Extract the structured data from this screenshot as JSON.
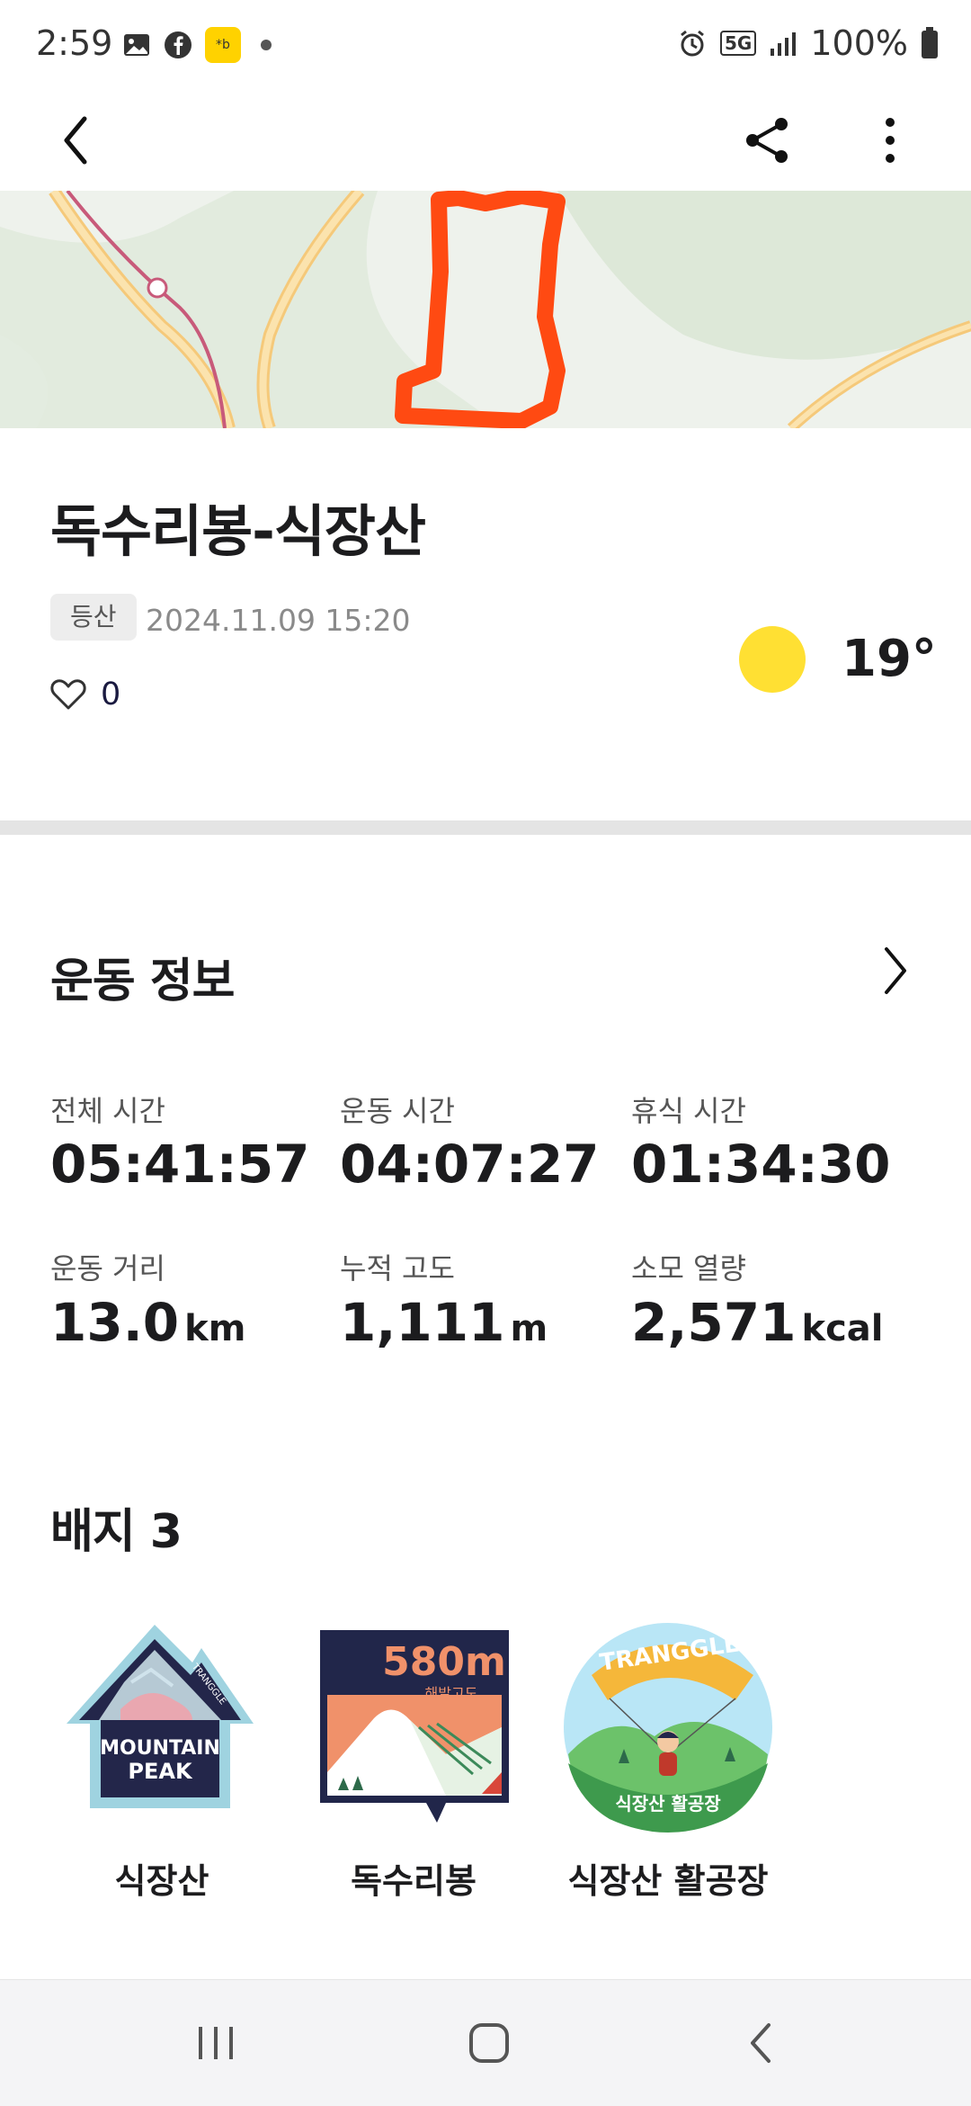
{
  "status_bar": {
    "time": "2:59",
    "network": "5G",
    "battery": "100%",
    "icons": [
      "gallery-icon",
      "facebook-icon",
      "kakao-icon",
      "dot-icon",
      "alarm-icon",
      "signal-icon",
      "battery-icon"
    ]
  },
  "header": {
    "icons": [
      "back-arrow-icon",
      "share-icon",
      "more-vertical-icon"
    ]
  },
  "activity": {
    "title": "독수리봉-식장산",
    "tag": "등산",
    "datetime": "2024.11.09 15:20",
    "likes": "0",
    "temperature": "19°",
    "weather_icon": "sun-icon",
    "route_color": "#ff4a12"
  },
  "exercise": {
    "title": "운동 정보",
    "stats": [
      {
        "label": "전체 시간",
        "value": "05:41:57",
        "unit": ""
      },
      {
        "label": "운동 시간",
        "value": "04:07:27",
        "unit": ""
      },
      {
        "label": "휴식 시간",
        "value": "01:34:30",
        "unit": ""
      },
      {
        "label": "운동 거리",
        "value": "13.0",
        "unit": "km"
      },
      {
        "label": "누적 고도",
        "value": "1,111",
        "unit": "m"
      },
      {
        "label": "소모 열량",
        "value": "2,571",
        "unit": "kcal"
      }
    ]
  },
  "badges": {
    "title": "배지 3",
    "items": [
      {
        "name": "식장산",
        "art_text": [
          "MOUNTAIN",
          "PEAK",
          "TRANGGLE"
        ]
      },
      {
        "name": "독수리봉",
        "art_text": [
          "580m",
          "해발고도"
        ]
      },
      {
        "name": "식장산 활공장",
        "art_text": [
          "TRANGGLE",
          "식장산 활공장"
        ]
      }
    ]
  },
  "nav": {
    "icons": [
      "recent-apps-icon",
      "home-icon",
      "back-icon"
    ]
  }
}
